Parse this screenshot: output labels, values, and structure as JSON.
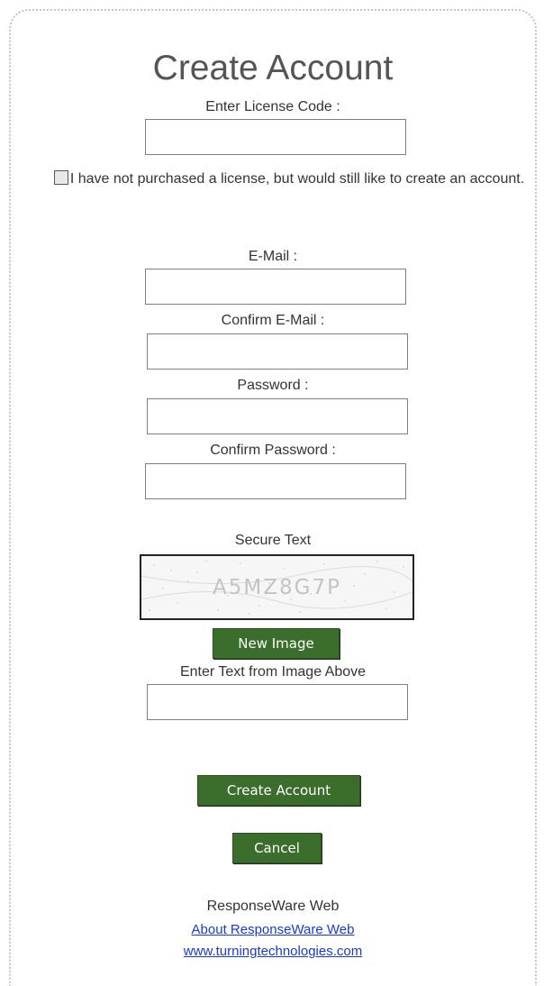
{
  "form": {
    "title": "Create Account",
    "license_label": "Enter License Code :",
    "license_value": "",
    "no_license_checkbox_checked": false,
    "no_license_label": "I have not purchased a license, but would still like to create an account.",
    "email_label": "E-Mail :",
    "email_value": "",
    "confirm_email_label": "Confirm E-Mail :",
    "confirm_email_value": "",
    "password_label": "Password :",
    "password_value": "",
    "confirm_password_label": "Confirm Password :",
    "confirm_password_value": "",
    "secure_text_label": "Secure Text",
    "captcha_text": "A5MZ8G7P",
    "new_image_button": "New Image",
    "captcha_entry_label": "Enter Text from Image Above",
    "captcha_entry_value": "",
    "create_account_button": "Create Account",
    "cancel_button": "Cancel"
  },
  "footer": {
    "product_name": "ResponseWare Web",
    "about_link": "About ResponseWare Web",
    "site_link": "www.turningtechnologies.com"
  },
  "colors": {
    "button_green": "#3b6e2d",
    "link_blue": "#1a3bd1",
    "frame_dots": "#c4c4c4"
  }
}
